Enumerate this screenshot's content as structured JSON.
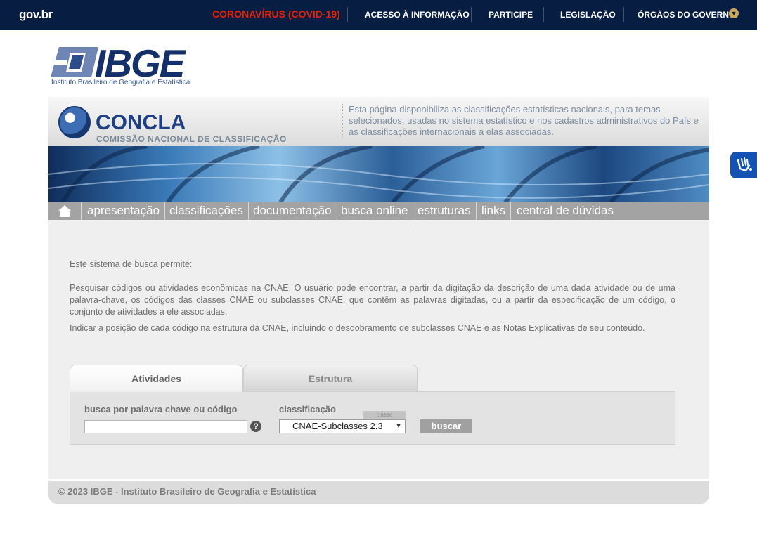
{
  "govbar": {
    "logo": "gov.br",
    "covid": "CORONAVÍRUS (COVID-19)",
    "links": [
      "ACESSO À INFORMAÇÃO",
      "PARTICIPE",
      "LEGISLAÇÃO",
      "ÓRGÃOS DO GOVERNO"
    ]
  },
  "ibge": {
    "logo_text": "IBGE",
    "subtitle": "Instituto Brasileiro de Geografia e Estatística"
  },
  "concla": {
    "title": "CONCLA",
    "subtitle": "COMISSÃO NACIONAL DE CLASSIFICAÇÃO",
    "description": "Esta página disponibiliza as classificações estatísticas nacionais, para temas selecionados, usadas no sistema estatístico e nos cadastros administrativos do País e as classificações internacionais a elas associadas."
  },
  "nav": {
    "items": [
      "apresentação",
      "classificações",
      "documentação",
      "busca online",
      "estruturas",
      "links",
      "central de dúvidas"
    ]
  },
  "content": {
    "intro": "Este sistema de busca permite:",
    "p1": "Pesquisar códigos ou atividades econômicas na CNAE. O usuário pode encontrar, a partir da digitação da descrição de uma dada atividade ou de uma palavra-chave, os códigos das classes CNAE ou subclasses CNAE, que contêm as palavras digitadas, ou a partir da especificação de um código, o conjunto de atividades a ele associadas;",
    "p2": "Indicar a posição de cada código na estrutura da CNAE, incluindo o desdobramento de subclasses CNAE e as Notas Explicativas de seu conteúdo."
  },
  "tabs": [
    "Atividades",
    "Estrutura"
  ],
  "form": {
    "search_label": "busca por palavra chave ou código",
    "search_value": "",
    "help": "?",
    "classification_label": "classificação",
    "classe_tag": "classe",
    "select_value": "CNAE-Subclasses 2.3",
    "button": "buscar"
  },
  "footer": "© 2023 IBGE - Instituto Brasileiro de Geografia e Estatística"
}
